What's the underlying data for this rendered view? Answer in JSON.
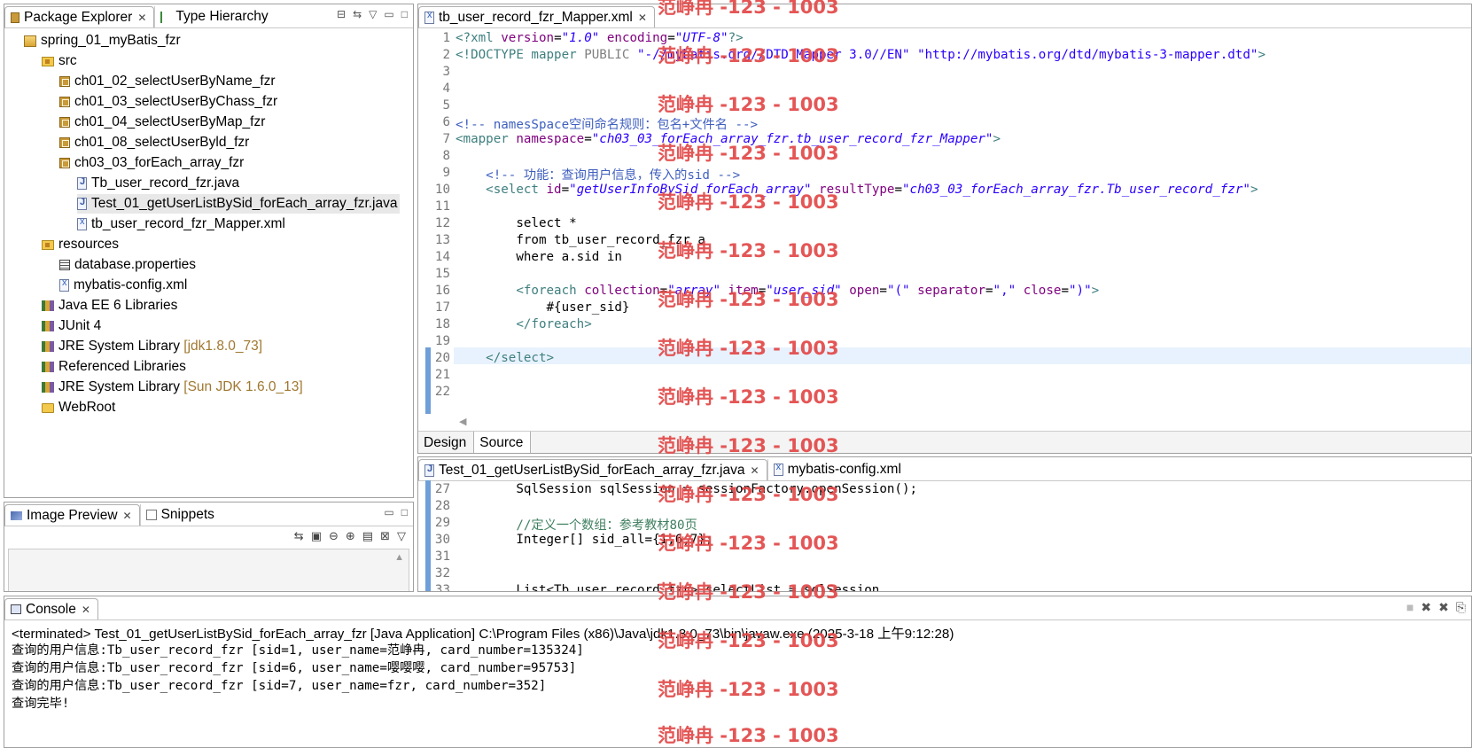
{
  "package_explorer": {
    "tab_label": "Package Explorer",
    "tab2_label": "Type Hierarchy",
    "tree": [
      {
        "label": "spring_01_myBatis_fzr",
        "icon": "project-icon"
      },
      {
        "label": "src",
        "icon": "source-folder-icon"
      },
      {
        "label": "ch01_02_selectUserByName_fzr",
        "icon": "package-icon"
      },
      {
        "label": "ch01_03_selectUserByChass_fzr",
        "icon": "package-icon"
      },
      {
        "label": "ch01_04_selectUserByMap_fzr",
        "icon": "package-icon"
      },
      {
        "label": "ch01_08_selectUserByld_fzr",
        "icon": "package-icon"
      },
      {
        "label": "ch03_03_forEach_array_fzr",
        "icon": "package-icon"
      },
      {
        "label": "Tb_user_record_fzr.java",
        "icon": "java-file-icon"
      },
      {
        "label": "Test_01_getUserListBySid_forEach_array_fzr.java",
        "icon": "java-file-icon"
      },
      {
        "label": "tb_user_record_fzr_Mapper.xml",
        "icon": "xml-file-icon"
      },
      {
        "label": "resources",
        "icon": "source-folder-icon"
      },
      {
        "label": "database.properties",
        "icon": "properties-file-icon"
      },
      {
        "label": "mybatis-config.xml",
        "icon": "xml-file-icon"
      },
      {
        "label": "Java EE 6 Libraries",
        "icon": "library-icon"
      },
      {
        "label": "JUnit 4",
        "icon": "library-icon"
      },
      {
        "label": "JRE System Library",
        "decoration": "[jdk1.8.0_73]",
        "icon": "library-icon"
      },
      {
        "label": "Referenced Libraries",
        "icon": "library-icon"
      },
      {
        "label": "JRE System Library",
        "decoration": "[Sun JDK 1.6.0_13]",
        "icon": "library-icon"
      },
      {
        "label": "WebRoot",
        "icon": "folder-icon"
      }
    ]
  },
  "image_preview": {
    "tab_label": "Image Preview",
    "tab2_label": "Snippets"
  },
  "xml_editor": {
    "tab_label": "tb_user_record_fzr_Mapper.xml",
    "bottom_tabs": [
      "Design",
      "Source"
    ],
    "line_numbers": [
      "1",
      "2",
      "3",
      "4",
      "5",
      "6",
      "7",
      "8",
      "9",
      "10",
      "11",
      "12",
      "13",
      "14",
      "15",
      "16",
      "17",
      "18",
      "19",
      "20",
      "21",
      "22"
    ]
  },
  "java_editor": {
    "tab_label": "Test_01_getUserListBySid_forEach_array_fzr.java",
    "tab2_label": "mybatis-config.xml",
    "line_numbers": [
      "27",
      "28",
      "29",
      "30",
      "31",
      "32",
      "33"
    ],
    "lines": [
      "        SqlSession sqlSession = sessionFactory.openSession();",
      "",
      "        //定义一个数组：参考教材80页",
      "        Integer[] sid_all={1,6,7};",
      "",
      "",
      "        List<Tb_user_record_fzr> selectList = sqlSession"
    ]
  },
  "console": {
    "tab_label": "Console",
    "status": "<terminated> Test_01_getUserListBySid_forEach_array_fzr [Java Application] C:\\Program Files (x86)\\Java\\jdk1.8.0_73\\bin\\javaw.exe (2025-3-18 上午9:12:28)",
    "output": [
      "查询的用户信息:Tb_user_record_fzr [sid=1, user_name=范峥冉, card_number=135324]",
      "查询的用户信息:Tb_user_record_fzr [sid=6, user_name=嘤嘤嘤, card_number=95753]",
      "查询的用户信息:Tb_user_record_fzr [sid=7, user_name=fzr, card_number=352]",
      "查询完毕!"
    ]
  },
  "watermark": "范峥冉 -123 - 1003",
  "colors": {
    "tag": "#3f7f7f",
    "attr": "#7f007f",
    "value": "#2a00ff",
    "comment": "#3f5fbf",
    "watermark": "#e24848"
  }
}
